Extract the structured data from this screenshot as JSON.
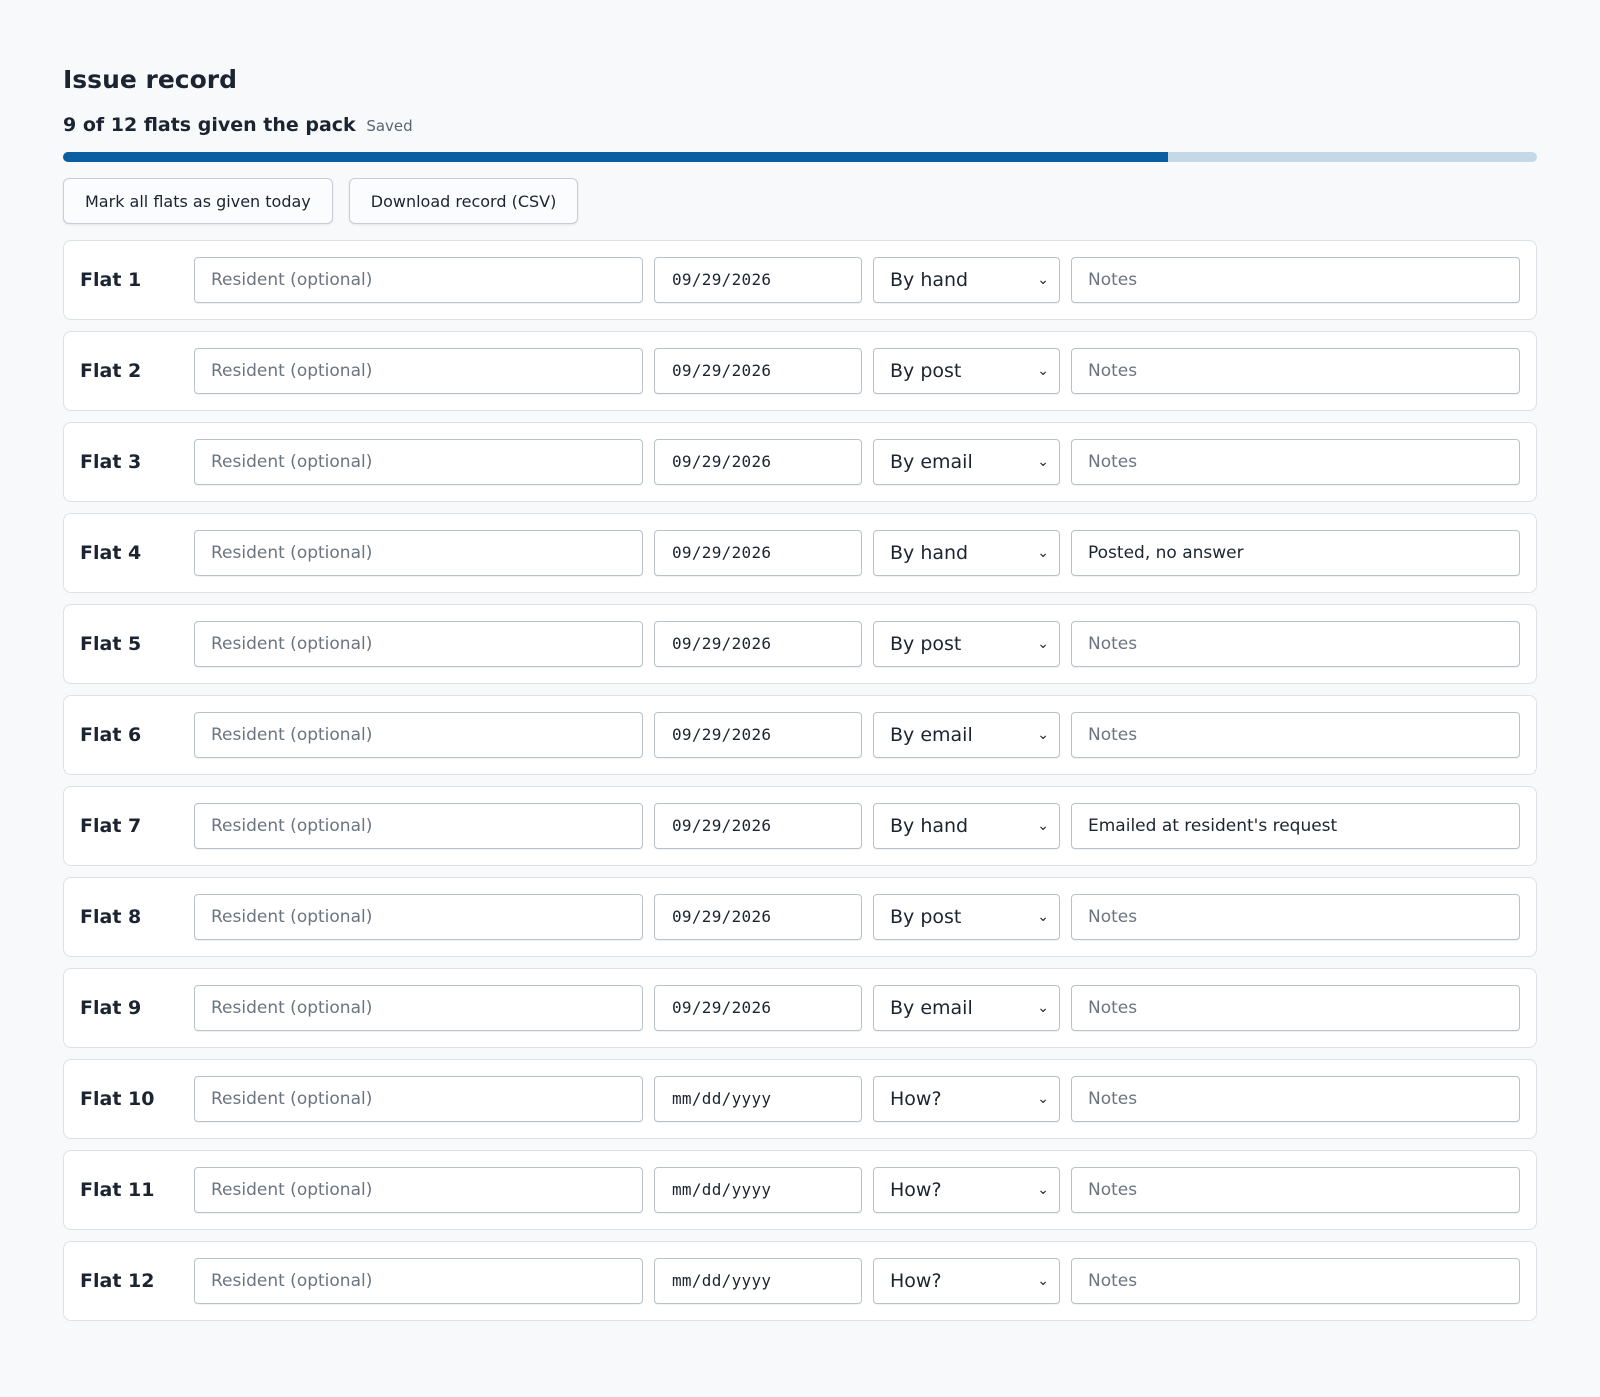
{
  "header": {
    "title": "Issue record",
    "summary": "9 of 12 flats given the pack",
    "saved": "Saved"
  },
  "progress": {
    "given": 9,
    "total": 12
  },
  "actions": {
    "mark_all": "Mark all flats as given today",
    "download": "Download record (CSV)"
  },
  "placeholders": {
    "resident": "Resident (optional)",
    "notes": "Notes"
  },
  "rows": [
    {
      "label": "Flat 1",
      "date": "09/29/2026",
      "method": "By hand",
      "notes": ""
    },
    {
      "label": "Flat 2",
      "date": "09/29/2026",
      "method": "By post",
      "notes": ""
    },
    {
      "label": "Flat 3",
      "date": "09/29/2026",
      "method": "By email",
      "notes": ""
    },
    {
      "label": "Flat 4",
      "date": "09/29/2026",
      "method": "By hand",
      "notes": "Posted, no answer"
    },
    {
      "label": "Flat 5",
      "date": "09/29/2026",
      "method": "By post",
      "notes": ""
    },
    {
      "label": "Flat 6",
      "date": "09/29/2026",
      "method": "By email",
      "notes": ""
    },
    {
      "label": "Flat 7",
      "date": "09/29/2026",
      "method": "By hand",
      "notes": "Emailed at resident's request"
    },
    {
      "label": "Flat 8",
      "date": "09/29/2026",
      "method": "By post",
      "notes": ""
    },
    {
      "label": "Flat 9",
      "date": "09/29/2026",
      "method": "By email",
      "notes": ""
    },
    {
      "label": "Flat 10",
      "date": "mm/dd/yyyy",
      "method": "How?",
      "notes": ""
    },
    {
      "label": "Flat 11",
      "date": "mm/dd/yyyy",
      "method": "How?",
      "notes": ""
    },
    {
      "label": "Flat 12",
      "date": "mm/dd/yyyy",
      "method": "How?",
      "notes": ""
    }
  ],
  "icons": {
    "select_arrow": "chevron-down-icon"
  },
  "colors": {
    "accent": "#0b5fa0",
    "progress_track": "#c5d8e7"
  }
}
